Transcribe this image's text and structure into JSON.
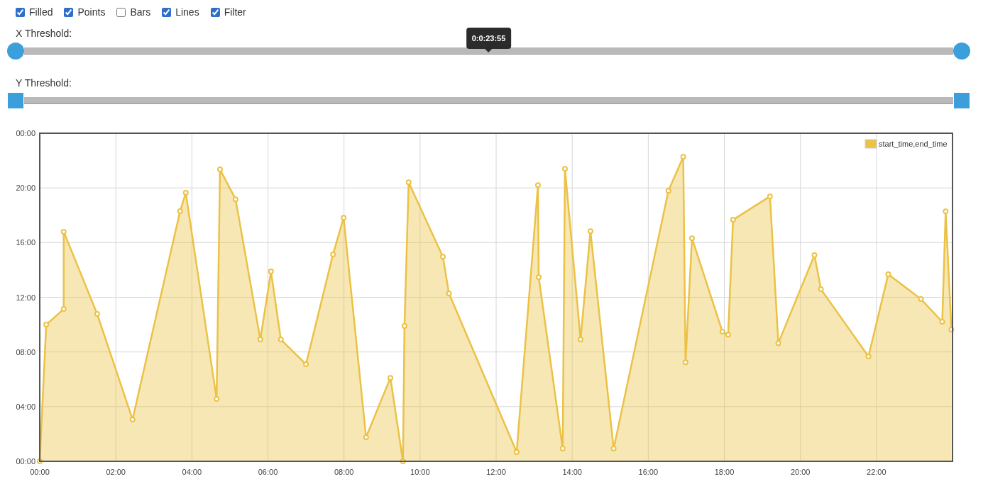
{
  "options": [
    {
      "label": "Filled",
      "checked": true
    },
    {
      "label": "Points",
      "checked": true
    },
    {
      "label": "Bars",
      "checked": false
    },
    {
      "label": "Lines",
      "checked": true
    },
    {
      "label": "Filter",
      "checked": true
    }
  ],
  "sliders": [
    {
      "label": "X Threshold:",
      "kind": "round",
      "tooltip": "0:0:23:55",
      "handles": [
        {
          "level": 0
        },
        {
          "level": 1
        }
      ]
    },
    {
      "label": "Y Threshold:",
      "kind": "square",
      "handles": [
        {
          "level": 0
        },
        {
          "level": 1
        }
      ]
    }
  ],
  "chart": {
    "chart_data": {
      "type": "area",
      "grid": true,
      "xlim": [
        0,
        24
      ],
      "ylim": [
        0,
        24
      ],
      "xticks": [
        {
          "value": 0,
          "label": "00:00"
        },
        {
          "value": 2,
          "label": "02:00"
        },
        {
          "value": 4,
          "label": "04:00"
        },
        {
          "value": 6,
          "label": "06:00"
        },
        {
          "value": 8,
          "label": "08:00"
        },
        {
          "value": 10,
          "label": "10:00"
        },
        {
          "value": 12,
          "label": "12:00"
        },
        {
          "value": 14,
          "label": "14:00"
        },
        {
          "value": 16,
          "label": "16:00"
        },
        {
          "value": 18,
          "label": "18:00"
        },
        {
          "value": 20,
          "label": "20:00"
        },
        {
          "value": 22,
          "label": "22:00"
        }
      ],
      "yticks": [
        {
          "value": 0,
          "label": "00:00"
        },
        {
          "value": 4,
          "label": "04:00"
        },
        {
          "value": 8,
          "label": "08:00"
        },
        {
          "value": 12,
          "label": "12:00"
        },
        {
          "value": 16,
          "label": "16:00"
        },
        {
          "value": 20,
          "label": "20:00"
        },
        {
          "value": 24,
          "label": "00:00"
        }
      ],
      "x": [
        0,
        0.17,
        0.63,
        0.63,
        1.51,
        2.44,
        3.69,
        3.84,
        4.65,
        4.74,
        5.15,
        5.8,
        6.08,
        6.34,
        7.0,
        7.71,
        7.99,
        8.58,
        9.22,
        9.55,
        9.59,
        9.7,
        10.6,
        10.76,
        12.54,
        13.1,
        13.12,
        13.75,
        13.81,
        14.22,
        14.48,
        15.09,
        16.53,
        16.92,
        16.98,
        17.15,
        17.95,
        18.1,
        18.23,
        19.2,
        19.42,
        20.37,
        20.54,
        21.79,
        22.31,
        23.17,
        23.73,
        23.82,
        23.97
      ],
      "series": [
        {
          "name": "start_time,end_time",
          "color": "#ebc246",
          "values": [
            0,
            10.0,
            11.14,
            16.8,
            10.78,
            3.06,
            18.3,
            19.64,
            4.56,
            21.35,
            19.17,
            8.91,
            13.89,
            8.91,
            7.1,
            15.13,
            17.82,
            1.76,
            6.11,
            0,
            9.9,
            20.41,
            14.97,
            12.28,
            0.67,
            20.2,
            13.47,
            0.93,
            21.4,
            8.91,
            16.84,
            0.93,
            19.79,
            22.28,
            7.25,
            16.32,
            9.48,
            9.27,
            17.67,
            19.38,
            8.65,
            15.08,
            12.59,
            7.67,
            13.68,
            11.87,
            10.21,
            18.29,
            9.64
          ]
        }
      ]
    }
  }
}
